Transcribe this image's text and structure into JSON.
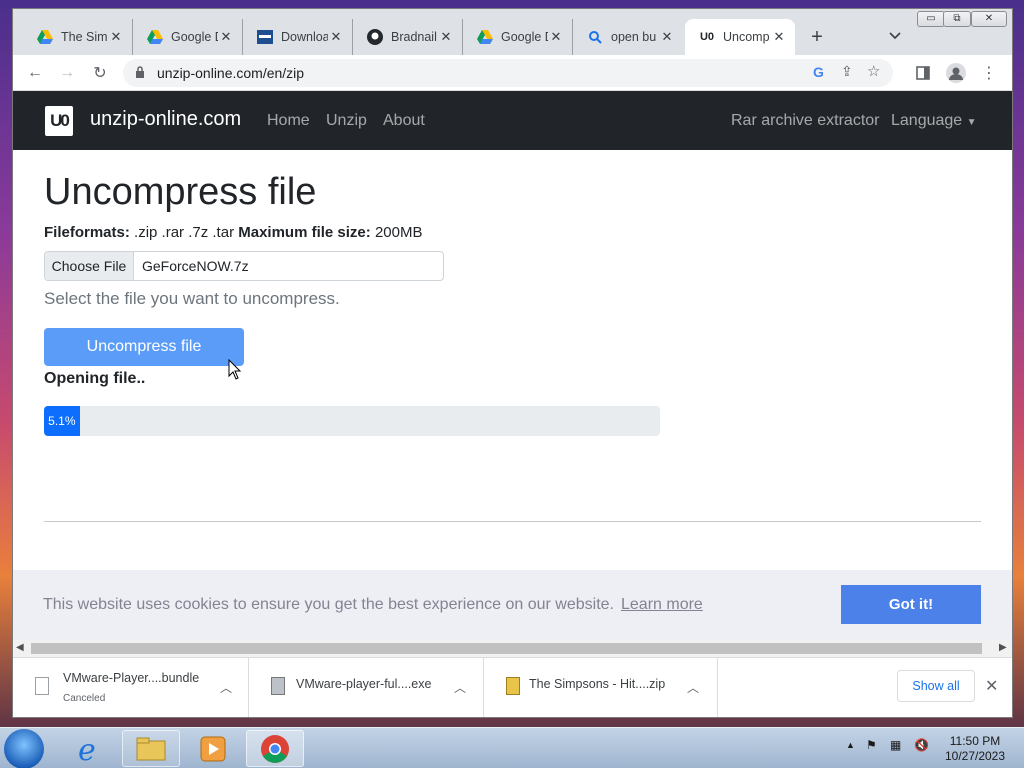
{
  "browser": {
    "tabs": [
      {
        "title": "The Simp",
        "favicon": "google-drive-icon"
      },
      {
        "title": "Google D",
        "favicon": "google-drive-icon"
      },
      {
        "title": "Downloa",
        "favicon": "vmware-icon"
      },
      {
        "title": "Bradnail",
        "favicon": "github-icon"
      },
      {
        "title": "Google D",
        "favicon": "google-drive-icon"
      },
      {
        "title": "open bu",
        "favicon": "search-icon"
      },
      {
        "title": "Uncomp",
        "favicon": "unzip-online-icon",
        "active": true
      }
    ],
    "url": "unzip-online.com/en/zip",
    "window_controls": {
      "minimize": "▭",
      "maximize": "⧉",
      "close": "✕"
    }
  },
  "site": {
    "logo_text": "U0",
    "brand": "unzip-online.com",
    "nav": [
      "Home",
      "Unzip",
      "About"
    ],
    "nav_right": {
      "rar": "Rar archive extractor",
      "language": "Language"
    },
    "heading": "Uncompress file",
    "formats_label": "Fileformats:",
    "formats_value": ".zip .rar .7z .tar",
    "max_label": "Maximum file size:",
    "max_value": "200MB",
    "choose_file_label": "Choose File",
    "file_name": "GeForceNOW.7z",
    "help_text": "Select the file you want to uncompress.",
    "button_label": "Uncompress file",
    "status_text": "Opening file..",
    "progress": {
      "value": 5.1,
      "label": "5.1%"
    },
    "cookie": {
      "message": "This website uses cookies to ensure you get the best experience on our website.",
      "learn_more": "Learn more",
      "accept": "Got it!"
    }
  },
  "downloads": {
    "items": [
      {
        "name": "VMware-Player....bundle",
        "status": "Canceled"
      },
      {
        "name": "VMware-player-ful....exe",
        "status": ""
      },
      {
        "name": "The Simpsons - Hit....zip",
        "status": ""
      }
    ],
    "show_all": "Show all"
  },
  "taskbar": {
    "time": "11:50 PM",
    "date": "10/27/2023"
  },
  "colors": {
    "navbar": "#212529",
    "button": "#5a9cf8",
    "progress_fill": "#0d6efd",
    "cookie_button": "#4b81e8"
  }
}
